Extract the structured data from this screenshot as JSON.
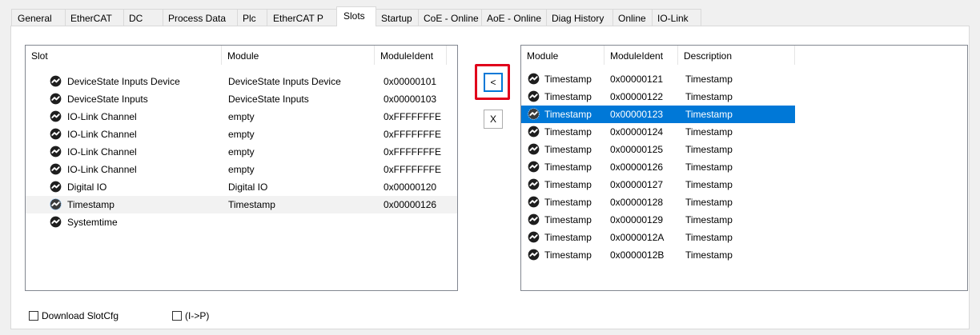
{
  "tabs": [
    {
      "label": "General",
      "active": false
    },
    {
      "label": "EtherCAT",
      "active": false
    },
    {
      "label": "DC",
      "active": false
    },
    {
      "label": "Process Data",
      "active": false
    },
    {
      "label": "Plc",
      "active": false
    },
    {
      "label": "EtherCAT P",
      "active": false
    },
    {
      "label": "Slots",
      "active": true
    },
    {
      "label": "Startup",
      "active": false
    },
    {
      "label": "CoE - Online",
      "active": false
    },
    {
      "label": "AoE - Online",
      "active": false
    },
    {
      "label": "Diag History",
      "active": false
    },
    {
      "label": "Online",
      "active": false
    },
    {
      "label": "IO-Link",
      "active": false
    }
  ],
  "slots": {
    "columns": [
      "Slot",
      "Module",
      "ModuleIdent"
    ],
    "rows": [
      {
        "slot": "DeviceState Inputs Device",
        "module": "DeviceState Inputs Device",
        "ident": "0x00000101",
        "state": "normal"
      },
      {
        "slot": "DeviceState Inputs",
        "module": "DeviceState Inputs",
        "ident": "0x00000103",
        "state": "normal"
      },
      {
        "slot": "IO-Link Channel",
        "module": "empty",
        "ident": "0xFFFFFFFE",
        "state": "normal"
      },
      {
        "slot": "IO-Link Channel",
        "module": "empty",
        "ident": "0xFFFFFFFE",
        "state": "normal"
      },
      {
        "slot": "IO-Link Channel",
        "module": "empty",
        "ident": "0xFFFFFFFE",
        "state": "normal"
      },
      {
        "slot": "IO-Link Channel",
        "module": "empty",
        "ident": "0xFFFFFFFE",
        "state": "normal"
      },
      {
        "slot": "Digital IO",
        "module": "Digital IO",
        "ident": "0x00000120",
        "state": "normal"
      },
      {
        "slot": "Timestamp",
        "module": "Timestamp",
        "ident": "0x00000126",
        "state": "selected-inactive"
      },
      {
        "slot": "Systemtime",
        "module": "",
        "ident": "",
        "state": "normal"
      }
    ]
  },
  "modules": {
    "columns": [
      "Module",
      "ModuleIdent",
      "Description"
    ],
    "rows": [
      {
        "module": "Timestamp",
        "ident": "0x00000121",
        "desc": "Timestamp",
        "state": "normal"
      },
      {
        "module": "Timestamp",
        "ident": "0x00000122",
        "desc": "Timestamp",
        "state": "normal"
      },
      {
        "module": "Timestamp",
        "ident": "0x00000123",
        "desc": "Timestamp",
        "state": "selected"
      },
      {
        "module": "Timestamp",
        "ident": "0x00000124",
        "desc": "Timestamp",
        "state": "normal"
      },
      {
        "module": "Timestamp",
        "ident": "0x00000125",
        "desc": "Timestamp",
        "state": "normal"
      },
      {
        "module": "Timestamp",
        "ident": "0x00000126",
        "desc": "Timestamp",
        "state": "normal"
      },
      {
        "module": "Timestamp",
        "ident": "0x00000127",
        "desc": "Timestamp",
        "state": "normal"
      },
      {
        "module": "Timestamp",
        "ident": "0x00000128",
        "desc": "Timestamp",
        "state": "normal"
      },
      {
        "module": "Timestamp",
        "ident": "0x00000129",
        "desc": "Timestamp",
        "state": "normal"
      },
      {
        "module": "Timestamp",
        "ident": "0x0000012A",
        "desc": "Timestamp",
        "state": "normal"
      },
      {
        "module": "Timestamp",
        "ident": "0x0000012B",
        "desc": "Timestamp",
        "state": "normal"
      }
    ]
  },
  "buttons": {
    "insert_label": "<",
    "remove_label": "X"
  },
  "checkboxes": {
    "download_slotcfg": {
      "label": "Download SlotCfg",
      "checked": false
    },
    "i_to_p": {
      "label": "(I->P)",
      "checked": false
    }
  },
  "icons": {
    "module_icon": "module-round-icon"
  },
  "colors": {
    "selection": "#0078d7",
    "highlight_frame": "#e0001b"
  }
}
